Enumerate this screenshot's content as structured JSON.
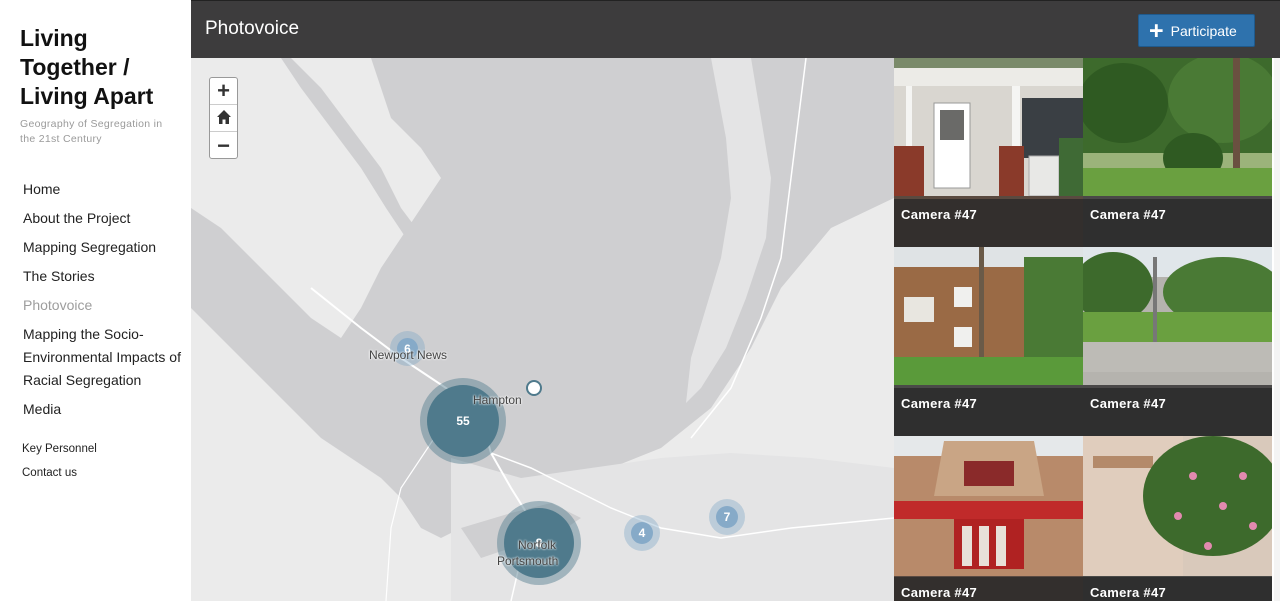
{
  "site": {
    "title": "Living Together / Living Apart",
    "subtitle": "Geography of Segregation in the 21st Century"
  },
  "nav": {
    "items": [
      {
        "label": "Home"
      },
      {
        "label": "About the Project"
      },
      {
        "label": "Mapping Segregation"
      },
      {
        "label": "The Stories"
      },
      {
        "label": "Photovoice",
        "active": true
      },
      {
        "label": "Mapping the Socio-Environmental Impacts of Racial Segregation"
      },
      {
        "label": "Media"
      }
    ],
    "secondary": [
      {
        "label": "Key Personnel"
      },
      {
        "label": "Contact us"
      }
    ]
  },
  "header": {
    "title": "Photovoice",
    "participate_label": "Participate",
    "participate_icon": "plus-icon"
  },
  "map": {
    "zoom_in": "+",
    "zoom_out": "−",
    "home_icon": "home-icon",
    "places": [
      "Newport News",
      "Hampton",
      "Norfolk",
      "Portsmouth"
    ],
    "clusters": [
      "6",
      "55",
      "4",
      "7",
      "8"
    ]
  },
  "photos": [
    {
      "caption": "Camera #47"
    },
    {
      "caption": "Camera #47"
    },
    {
      "caption": "Camera #47"
    },
    {
      "caption": "Camera #47"
    },
    {
      "caption": "Camera #47"
    },
    {
      "caption": "Camera #47"
    }
  ],
  "colors": {
    "topbar": "#3d3c3d",
    "accent": "#2e72ad",
    "cluster": "#4f7a8c",
    "water": "#cfcfd1",
    "land": "#ebebeb"
  }
}
